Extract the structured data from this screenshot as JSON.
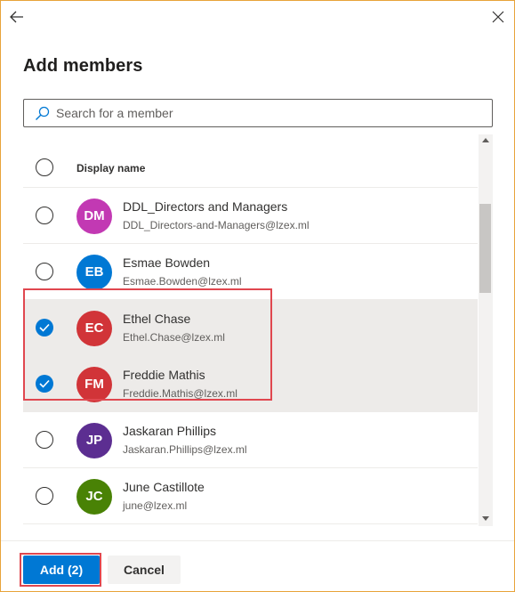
{
  "dialog": {
    "title": "Add members",
    "back_icon": "arrow-left-icon",
    "close_icon": "close-icon"
  },
  "search": {
    "placeholder": "Search for a member",
    "value": "",
    "icon": "search-icon"
  },
  "list": {
    "header_label": "Display name",
    "members": [
      {
        "initials": "DM",
        "name": "DDL_Directors and Managers",
        "email": "DDL_Directors-and-Managers@lzex.ml",
        "color": "#c239b3",
        "selected": false
      },
      {
        "initials": "EB",
        "name": "Esmae Bowden",
        "email": "Esmae.Bowden@lzex.ml",
        "color": "#0078d4",
        "selected": false
      },
      {
        "initials": "EC",
        "name": "Ethel Chase",
        "email": "Ethel.Chase@lzex.ml",
        "color": "#d13438",
        "selected": true
      },
      {
        "initials": "FM",
        "name": "Freddie Mathis",
        "email": "Freddie.Mathis@lzex.ml",
        "color": "#d13438",
        "selected": true
      },
      {
        "initials": "JP",
        "name": "Jaskaran Phillips",
        "email": "Jaskaran.Phillips@lzex.ml",
        "color": "#5c2e91",
        "selected": false
      },
      {
        "initials": "JC",
        "name": "June Castillote",
        "email": "june@lzex.ml",
        "color": "#498205",
        "selected": false
      }
    ]
  },
  "footer": {
    "add_label": "Add (2)",
    "cancel_label": "Cancel"
  },
  "colors": {
    "accent": "#0078d4",
    "highlight": "#e0474f"
  }
}
